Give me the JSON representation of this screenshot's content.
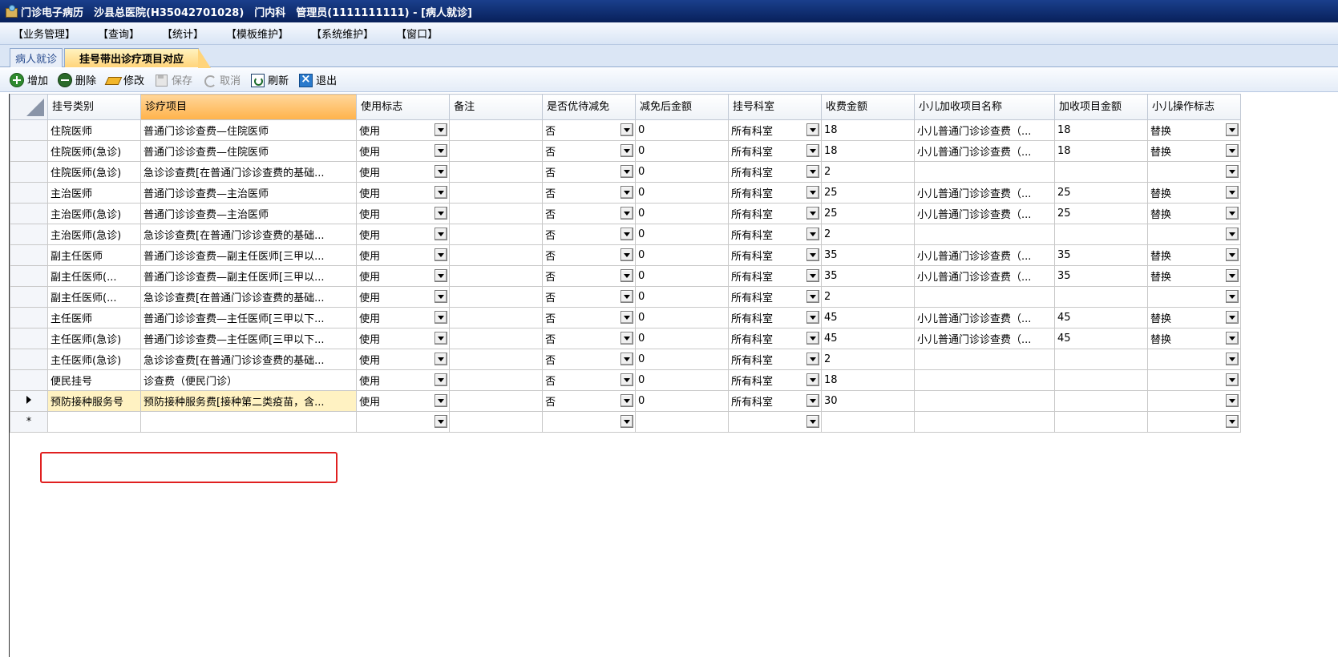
{
  "titlebar": {
    "title": "门诊电子病历　沙县总医院(H35042701028)　门内科　管理员(1111111111) - [病人就诊]"
  },
  "menu": [
    "【业务管理】",
    "【查询】",
    "【统计】",
    "【模板维护】",
    "【系统维护】",
    "【窗口】"
  ],
  "tabs": {
    "inactive": "病人就诊",
    "active": "挂号带出诊疗项目对应"
  },
  "toolbar": {
    "add": "增加",
    "delete": "删除",
    "edit": "修改",
    "save": "保存",
    "cancel": "取消",
    "refresh": "刷新",
    "exit": "退出"
  },
  "grid": {
    "headers": [
      "挂号类别",
      "诊疗项目",
      "使用标志",
      "备注",
      "是否优待减免",
      "减免后金额",
      "挂号科室",
      "收费金额",
      "小儿加收项目名称",
      "加收项目金额",
      "小儿操作标志"
    ],
    "rows": [
      [
        "住院医师",
        "普通门诊诊查费—住院医师",
        "使用",
        "",
        "否",
        "0",
        "所有科室",
        "18",
        "小儿普通门诊诊查费（...",
        "18",
        "替换"
      ],
      [
        "住院医师(急诊)",
        "普通门诊诊查费—住院医师",
        "使用",
        "",
        "否",
        "0",
        "所有科室",
        "18",
        "小儿普通门诊诊查费（...",
        "18",
        "替换"
      ],
      [
        "住院医师(急诊)",
        "急诊诊查费[在普通门诊诊查费的基础...",
        "使用",
        "",
        "否",
        "0",
        "所有科室",
        "2",
        "",
        "",
        ""
      ],
      [
        "主治医师",
        "普通门诊诊查费—主治医师",
        "使用",
        "",
        "否",
        "0",
        "所有科室",
        "25",
        "小儿普通门诊诊查费（...",
        "25",
        "替换"
      ],
      [
        "主治医师(急诊)",
        "普通门诊诊查费—主治医师",
        "使用",
        "",
        "否",
        "0",
        "所有科室",
        "25",
        "小儿普通门诊诊查费（...",
        "25",
        "替换"
      ],
      [
        "主治医师(急诊)",
        "急诊诊查费[在普通门诊诊查费的基础...",
        "使用",
        "",
        "否",
        "0",
        "所有科室",
        "2",
        "",
        "",
        ""
      ],
      [
        "副主任医师",
        "普通门诊诊查费—副主任医师[三甲以...",
        "使用",
        "",
        "否",
        "0",
        "所有科室",
        "35",
        "小儿普通门诊诊查费（...",
        "35",
        "替换"
      ],
      [
        "副主任医师(...",
        "普通门诊诊查费—副主任医师[三甲以...",
        "使用",
        "",
        "否",
        "0",
        "所有科室",
        "35",
        "小儿普通门诊诊查费（...",
        "35",
        "替换"
      ],
      [
        "副主任医师(...",
        "急诊诊查费[在普通门诊诊查费的基础...",
        "使用",
        "",
        "否",
        "0",
        "所有科室",
        "2",
        "",
        "",
        ""
      ],
      [
        "主任医师",
        "普通门诊诊查费—主任医师[三甲以下...",
        "使用",
        "",
        "否",
        "0",
        "所有科室",
        "45",
        "小儿普通门诊诊查费（...",
        "45",
        "替换"
      ],
      [
        "主任医师(急诊)",
        "普通门诊诊查费—主任医师[三甲以下...",
        "使用",
        "",
        "否",
        "0",
        "所有科室",
        "45",
        "小儿普通门诊诊查费（...",
        "45",
        "替换"
      ],
      [
        "主任医师(急诊)",
        "急诊诊查费[在普通门诊诊查费的基础...",
        "使用",
        "",
        "否",
        "0",
        "所有科室",
        "2",
        "",
        "",
        ""
      ],
      [
        "便民挂号",
        "诊查费（便民门诊）",
        "使用",
        "",
        "否",
        "0",
        "所有科室",
        "18",
        "",
        "",
        ""
      ],
      [
        "预防接种服务号",
        "预防接种服务费[接种第二类疫苗，含...",
        "使用",
        "",
        "否",
        "0",
        "所有科室",
        "30",
        "",
        "",
        ""
      ]
    ],
    "new_row_marker": "*"
  }
}
